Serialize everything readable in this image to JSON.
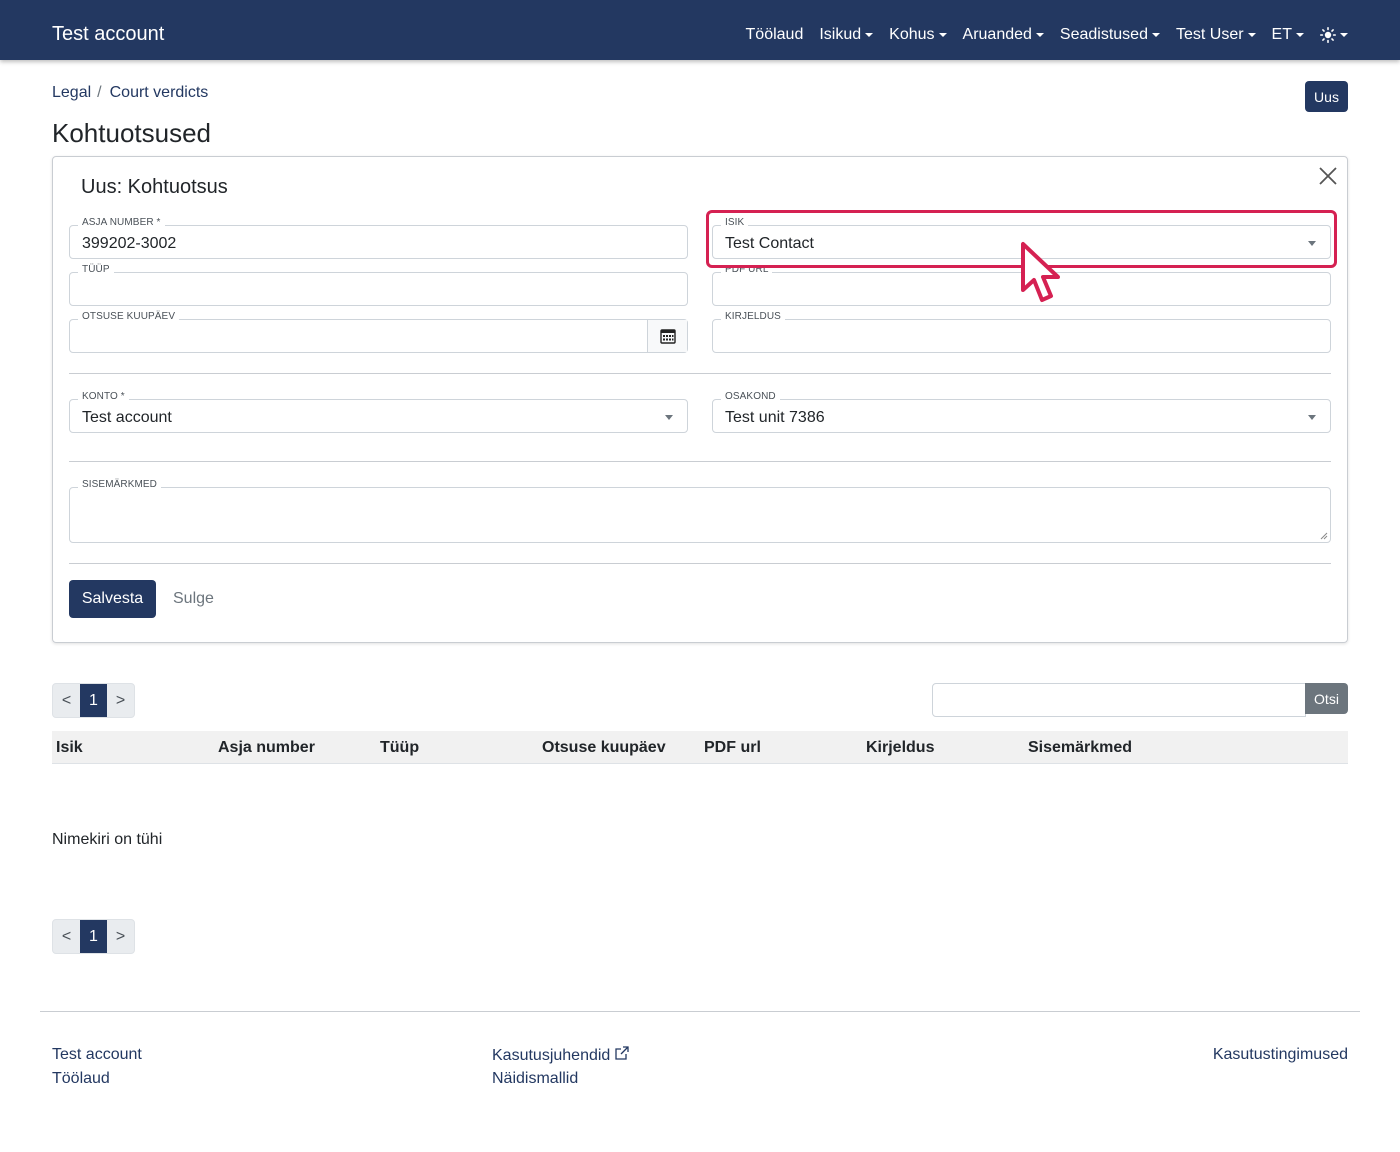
{
  "navbar": {
    "brand": "Test account",
    "items": [
      {
        "label": "Töölaud",
        "dropdown": false
      },
      {
        "label": "Isikud",
        "dropdown": true
      },
      {
        "label": "Kohus",
        "dropdown": true
      },
      {
        "label": "Aruanded",
        "dropdown": true
      },
      {
        "label": "Seadistused",
        "dropdown": true
      },
      {
        "label": "Test User",
        "dropdown": true
      },
      {
        "label": "ET",
        "dropdown": true
      }
    ],
    "theme_icon": "sun-icon"
  },
  "breadcrumb": [
    "Legal",
    "Court verdicts"
  ],
  "new_button": "Uus",
  "page_title": "Kohtuotsused",
  "form": {
    "title": "Uus: Kohtuotsus",
    "close_icon": "close-icon",
    "case_number": {
      "label": "ASJA NUMBER *",
      "value": "399202-3002"
    },
    "person": {
      "label": "ISIK",
      "value": "Test Contact"
    },
    "type": {
      "label": "TÜÜP",
      "value": ""
    },
    "pdf_url": {
      "label": "PDF URL",
      "value": ""
    },
    "decision_date": {
      "label": "OTSUSE KUUPÄEV",
      "value": "",
      "icon": "calendar-icon"
    },
    "description": {
      "label": "KIRJELDUS",
      "value": ""
    },
    "account": {
      "label": "KONTO *",
      "value": "Test account"
    },
    "unit": {
      "label": "OSAKOND",
      "value": "Test unit 7386"
    },
    "internal_notes": {
      "label": "SISEMÄRKMED",
      "value": ""
    },
    "save_label": "Salvesta",
    "close_label": "Sulge"
  },
  "pagination": {
    "prev": "<",
    "page": "1",
    "next": ">"
  },
  "search": {
    "value": "",
    "button": "Otsi"
  },
  "table": {
    "columns": [
      "Isik",
      "Asja number",
      "Tüüp",
      "Otsuse kuupäev",
      "PDF url",
      "Kirjeldus",
      "Sisemärkmed"
    ],
    "empty_text": "Nimekiri on tühi"
  },
  "footer": {
    "col1": [
      "Test account",
      "Töölaud"
    ],
    "col2": [
      "Kasutusjuhendid",
      "Näidismallid"
    ],
    "col3": [
      "Kasutustingimused"
    ]
  },
  "colors": {
    "primary": "#233861",
    "highlight": "#d52152"
  }
}
